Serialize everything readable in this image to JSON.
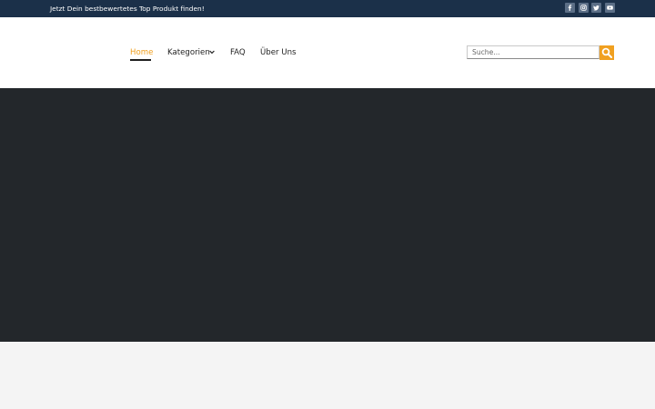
{
  "topbar": {
    "text": "Jetzt Dein bestbewertetes Top Produkt finden!",
    "social": [
      "facebook-icon",
      "instagram-icon",
      "twitter-icon",
      "youtube-icon"
    ]
  },
  "nav": {
    "items": [
      {
        "label": "Home",
        "active": true
      },
      {
        "label": "Kategorien",
        "has_dropdown": true
      },
      {
        "label": "FAQ"
      },
      {
        "label": "Über Uns"
      }
    ]
  },
  "search": {
    "placeholder": "Suche..."
  },
  "colors": {
    "topbar": "#1b3049",
    "accent": "#f0a020",
    "hero": "#23272b",
    "footer": "#f4f4f4"
  }
}
